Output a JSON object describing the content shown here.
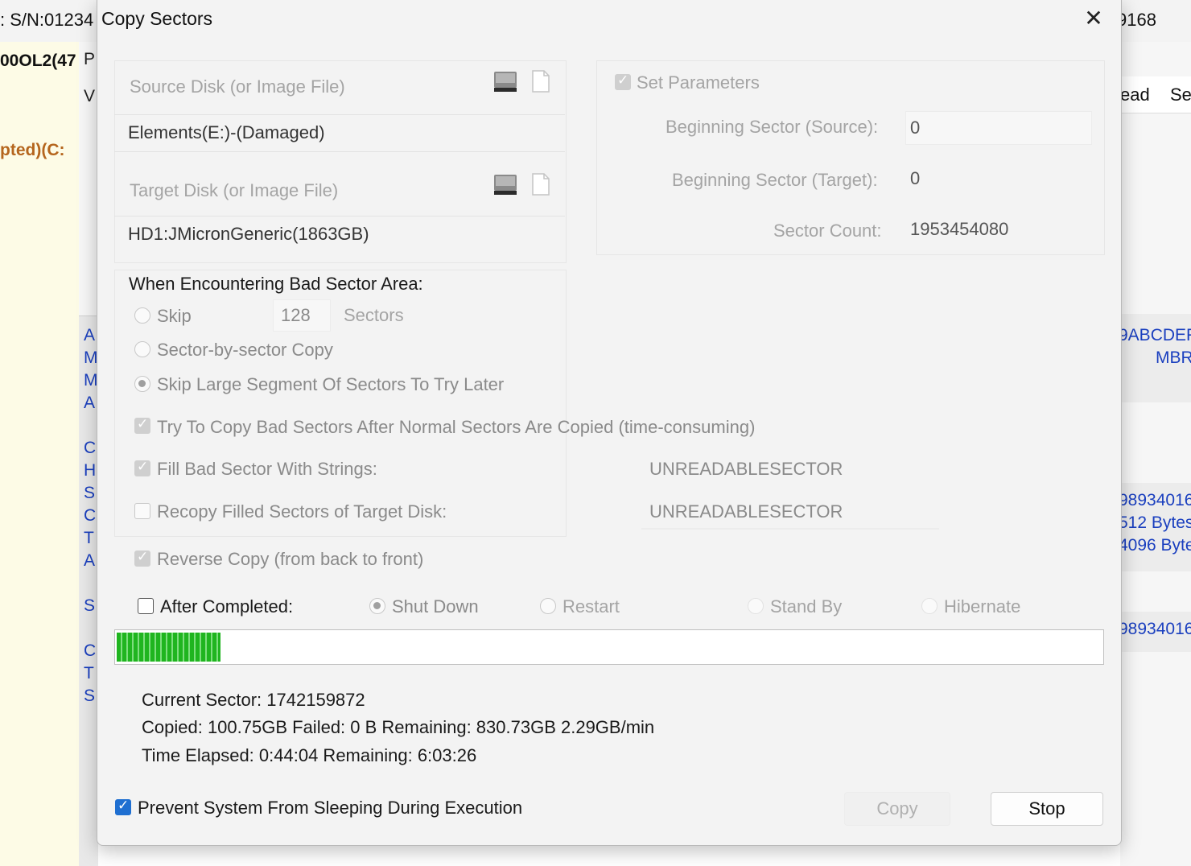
{
  "background": {
    "serial_text": ": S/N:01234",
    "serial_right": "9168",
    "disk_label": "00OL2(47",
    "partition_label": "pted)(C:",
    "mid_letters_top": "P",
    "mid_letters_v": "V",
    "mid_letters_blue": [
      "A",
      "M",
      "M",
      "A",
      "",
      "C",
      "H",
      "S",
      "C",
      "T",
      "A",
      "",
      "S",
      "",
      "C",
      "T",
      "S"
    ],
    "right_header": [
      "ead",
      "Se"
    ],
    "right_values": [
      "9ABCDEF",
      "MBR",
      "98934016",
      "512 Bytes",
      "4096 Bytes",
      "98934016"
    ]
  },
  "dialog": {
    "title": "Copy Sectors",
    "close_symbol": "✕",
    "source": {
      "label": "Source Disk (or Image File)",
      "value": "Elements(E:)-(Damaged)"
    },
    "target": {
      "label": "Target Disk (or Image File)",
      "value": "HD1:JMicronGeneric(1863GB)"
    },
    "params": {
      "set_label": "Set Parameters",
      "begin_source_label": "Beginning Sector (Source):",
      "begin_source_value": "0",
      "begin_target_label": "Beginning Sector (Target):",
      "begin_target_value": "0",
      "sector_count_label": "Sector Count:",
      "sector_count_value": "1953454080"
    },
    "bad_sector": {
      "heading": "When Encountering Bad Sector Area:",
      "skip_label": "Skip",
      "skip_value": "128",
      "skip_unit": "Sectors",
      "sector_by_sector": "Sector-by-sector Copy",
      "skip_large": "Skip Large Segment Of Sectors To Try Later",
      "try_copy": "Try To Copy Bad Sectors After Normal Sectors Are Copied (time-consuming)",
      "fill_label": "Fill Bad Sector With Strings:",
      "fill_value": "UNREADABLESECTOR",
      "recopy_label": "Recopy Filled Sectors of Target Disk:",
      "recopy_value": "UNREADABLESECTOR",
      "reverse": "Reverse Copy (from back to front)"
    },
    "after": {
      "label": "After Completed:",
      "options": [
        "Shut Down",
        "Restart",
        "Stand By",
        "Hibernate"
      ]
    },
    "progress_fraction": 0.105,
    "stats": {
      "current_sector": "Current Sector: 1742159872",
      "copied_line": "Copied: 100.75GB  Failed: 0 B  Remaining: 830.73GB  2.29GB/min",
      "time_line": "Time Elapsed:  0:44:04  Remaining:  6:03:26"
    },
    "prevent_sleep": "Prevent System From Sleeping During Execution",
    "buttons": {
      "copy": "Copy",
      "stop": "Stop"
    }
  }
}
